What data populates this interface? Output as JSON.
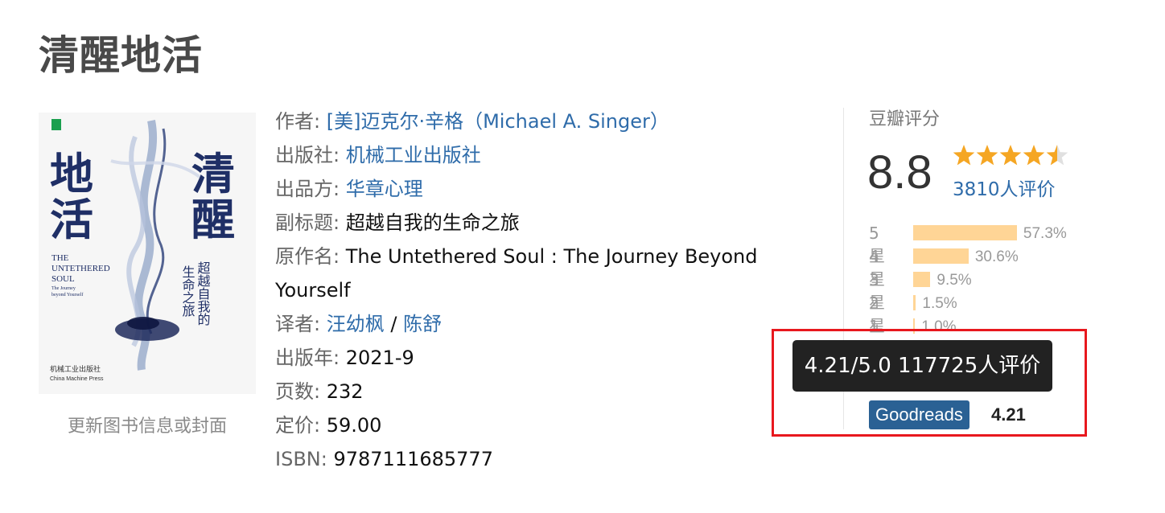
{
  "book": {
    "title": "清醒地活",
    "update_link": "更新图书信息或封面",
    "cover": {
      "title_chars": [
        "清",
        "醒",
        "地",
        "活"
      ],
      "subtitle_chars": [
        "超越自我的",
        "生命之旅"
      ],
      "en_title_1": "THE",
      "en_title_2": "UNTETHERED",
      "en_title_3": "SOUL",
      "en_sub_1": "The Journey",
      "en_sub_2": "beyond Yourself",
      "publisher_logo": "机械工业出版社",
      "publisher_en": "China Machine Press"
    }
  },
  "info": {
    "author_label": "作者:",
    "author_value": "[美]迈克尔·辛格（Michael A. Singer）",
    "publisher_label": "出版社:",
    "publisher_value": "机械工业出版社",
    "producer_label": "出品方:",
    "producer_value": "华章心理",
    "subtitle_label": "副标题:",
    "subtitle_value": "超越自我的生命之旅",
    "original_label": "原作名:",
    "original_value_1": "The Untethered Soul : The Journey Beyond",
    "original_value_2": "Yourself",
    "translator_label": "译者:",
    "translator_1": "汪幼枫",
    "translator_sep": " / ",
    "translator_2": "陈舒",
    "year_label": "出版年:",
    "year_value": "2021-9",
    "pages_label": "页数:",
    "pages_value": "232",
    "price_label": "定价:",
    "price_value": "59.00",
    "isbn_label": "ISBN:",
    "isbn_value": "9787111685777"
  },
  "rating": {
    "heading": "豆瓣评分",
    "score": "8.8",
    "stars": 4.5,
    "people": "3810人评价",
    "accent_color": "#f5a623",
    "distribution": [
      {
        "label": "5星",
        "pct_text": "57.3%",
        "pct": 57.3
      },
      {
        "label": "4星",
        "pct_text": "30.6%",
        "pct": 30.6
      },
      {
        "label": "3星",
        "pct_text": "9.5%",
        "pct": 9.5
      },
      {
        "label": "2星",
        "pct_text": "1.5%",
        "pct": 1.5
      },
      {
        "label": "1星",
        "pct_text": "1.0%",
        "pct": 1.0
      }
    ],
    "tooltip": "4.21/5.0 117725人评价",
    "goodreads_label": "Goodreads",
    "goodreads_score": "4.21",
    "highlight_color": "#e8181e"
  }
}
